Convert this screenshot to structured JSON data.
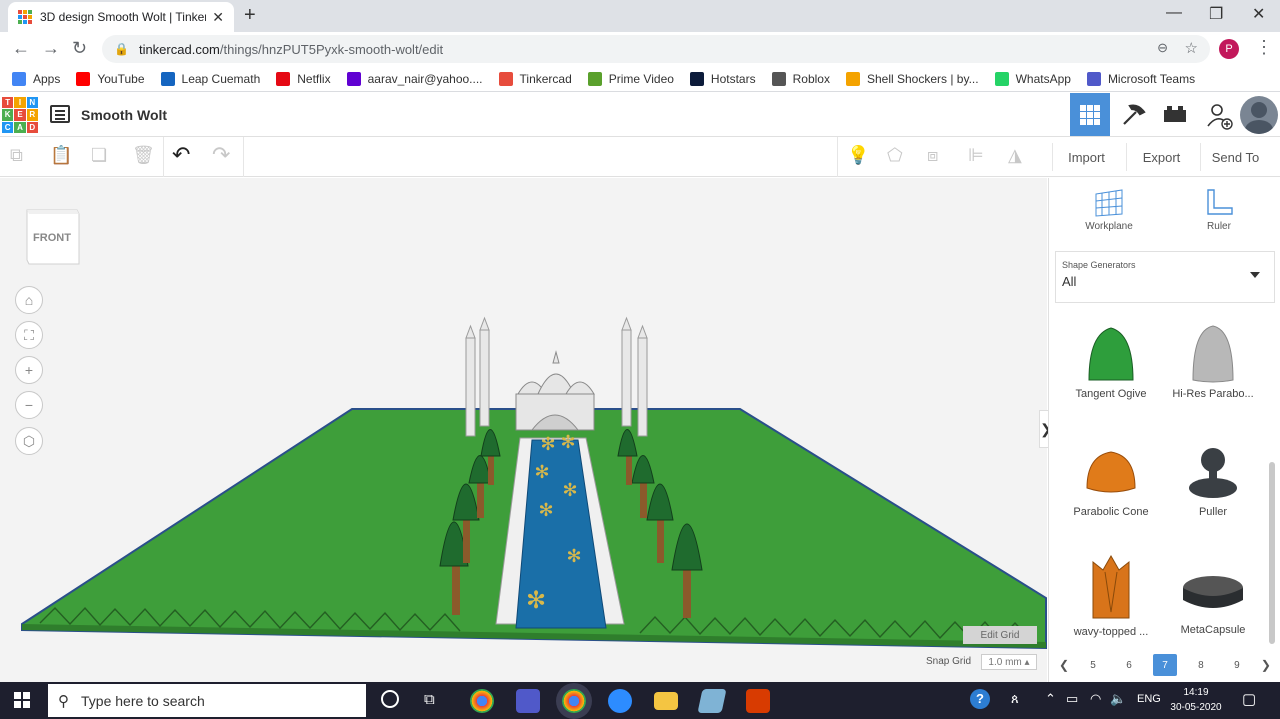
{
  "browser": {
    "tab_title": "3D design Smooth Wolt | Tinkerc",
    "url_host": "tinkercad.com",
    "url_path": "/things/hnzPUT5Pyxk-smooth-wolt/edit",
    "profile_initial": "P"
  },
  "bookmarks": [
    {
      "label": "Apps",
      "color": "#4285f4"
    },
    {
      "label": "YouTube",
      "color": "#ff0000"
    },
    {
      "label": "Leap Cuemath",
      "color": "#1565c0"
    },
    {
      "label": "Netflix",
      "color": "#e50914"
    },
    {
      "label": "aarav_nair@yahoo....",
      "color": "#6001d2"
    },
    {
      "label": "Tinkercad",
      "color": "#e74c3c"
    },
    {
      "label": "Prime Video",
      "color": "#5aa02c"
    },
    {
      "label": "Hotstars",
      "color": "#0c1b3a"
    },
    {
      "label": "Roblox",
      "color": "#555555"
    },
    {
      "label": "Shell Shockers | by...",
      "color": "#f4a300"
    },
    {
      "label": "WhatsApp",
      "color": "#25d366"
    },
    {
      "label": "Microsoft Teams",
      "color": "#5059c9"
    }
  ],
  "app": {
    "logo_letters": [
      "T",
      "I",
      "N",
      "K",
      "E",
      "R",
      "C",
      "A",
      "D"
    ],
    "project_title": "Smooth Wolt"
  },
  "toolbar": {
    "import_label": "Import",
    "export_label": "Export",
    "send_to_label": "Send To"
  },
  "viewport": {
    "viewcube_label": "FRONT",
    "edit_grid_label": "Edit Grid",
    "snap_grid_label": "Snap Grid",
    "snap_grid_value": "1.0 mm"
  },
  "panel": {
    "workplane_label": "Workplane",
    "ruler_label": "Ruler",
    "shape_generators_label": "Shape Generators",
    "shape_generators_value": "All",
    "shapes": [
      {
        "label": "Tangent Ogive",
        "color": "#2e9e3c"
      },
      {
        "label": "Hi-Res Parabo...",
        "color": "#b8b8b8"
      },
      {
        "label": "Parabolic Cone",
        "color": "#e07b1a"
      },
      {
        "label": "Puller",
        "color": "#3a3f44"
      },
      {
        "label": "wavy-topped ...",
        "color": "#d8741a"
      },
      {
        "label": "MetaCapsule",
        "color": "#2a2d30"
      }
    ],
    "pages": [
      "5",
      "6",
      "7",
      "8",
      "9"
    ],
    "active_page": "7"
  },
  "taskbar": {
    "search_placeholder": "Type here to search",
    "language": "ENG",
    "time": "14:19",
    "date": "30-05-2020"
  }
}
